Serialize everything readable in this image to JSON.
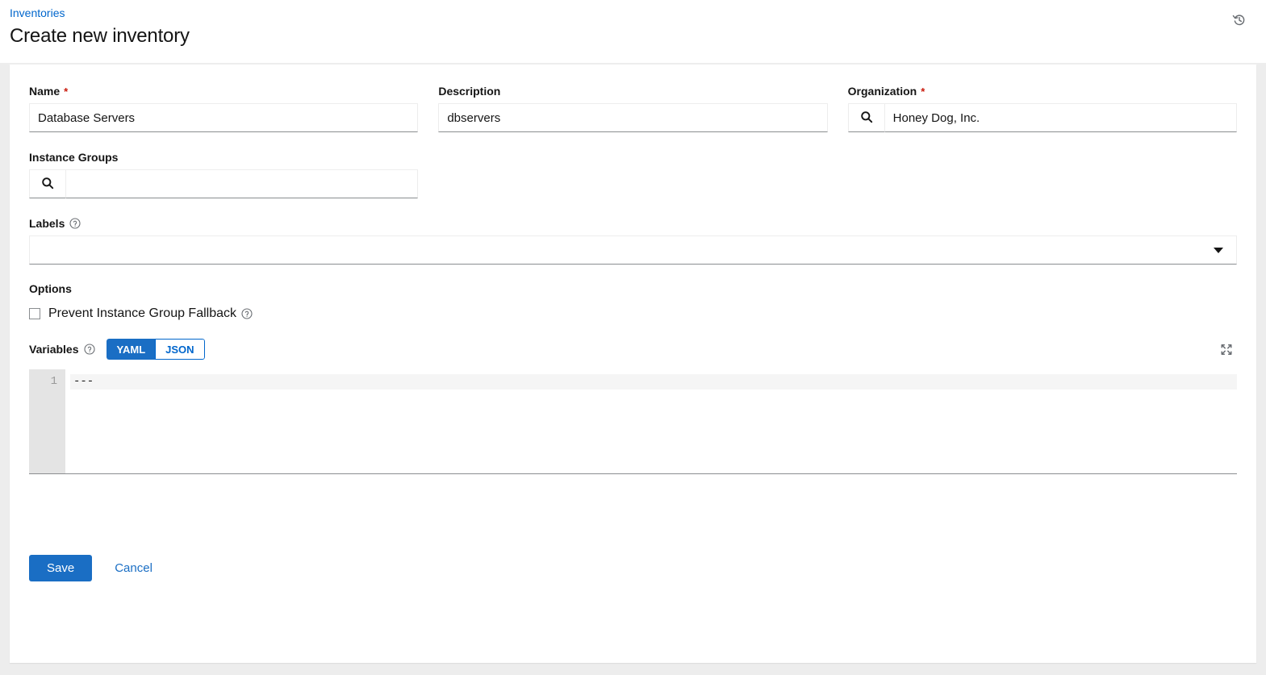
{
  "header": {
    "breadcrumb": "Inventories",
    "title": "Create new inventory",
    "history_icon": "history-icon"
  },
  "form": {
    "name": {
      "label": "Name",
      "required": "*",
      "value": "Database Servers",
      "placeholder": ""
    },
    "description": {
      "label": "Description",
      "value": "dbservers",
      "placeholder": ""
    },
    "organization": {
      "label": "Organization",
      "required": "*",
      "value": "Honey Dog, Inc.",
      "placeholder": "",
      "search_icon": "search-icon"
    },
    "instance_groups": {
      "label": "Instance Groups",
      "value": "",
      "placeholder": "",
      "search_icon": "search-icon"
    },
    "labels": {
      "label": "Labels",
      "help_icon": "question-circle-icon",
      "value": "",
      "caret_icon": "caret-down-icon"
    },
    "options": {
      "title": "Options",
      "prevent_fallback": {
        "label": "Prevent Instance Group Fallback",
        "checked": false,
        "help_icon": "question-circle-icon"
      }
    },
    "variables": {
      "title": "Variables",
      "help_icon": "question-circle-icon",
      "modes": [
        {
          "label": "YAML",
          "active": true
        },
        {
          "label": "JSON",
          "active": false
        }
      ],
      "expand_icon": "expand-arrows-icon",
      "lines": [
        {
          "number": "1",
          "text": "---"
        }
      ]
    }
  },
  "actions": {
    "save_label": "Save",
    "cancel_label": "Cancel"
  },
  "colors": {
    "accent_blue": "#1a6ec4",
    "link_blue": "#0066cc",
    "required_red": "#c9190b",
    "page_bg": "#ededed",
    "card_bg": "#ffffff",
    "gutter_bg": "#e4e4e4"
  }
}
